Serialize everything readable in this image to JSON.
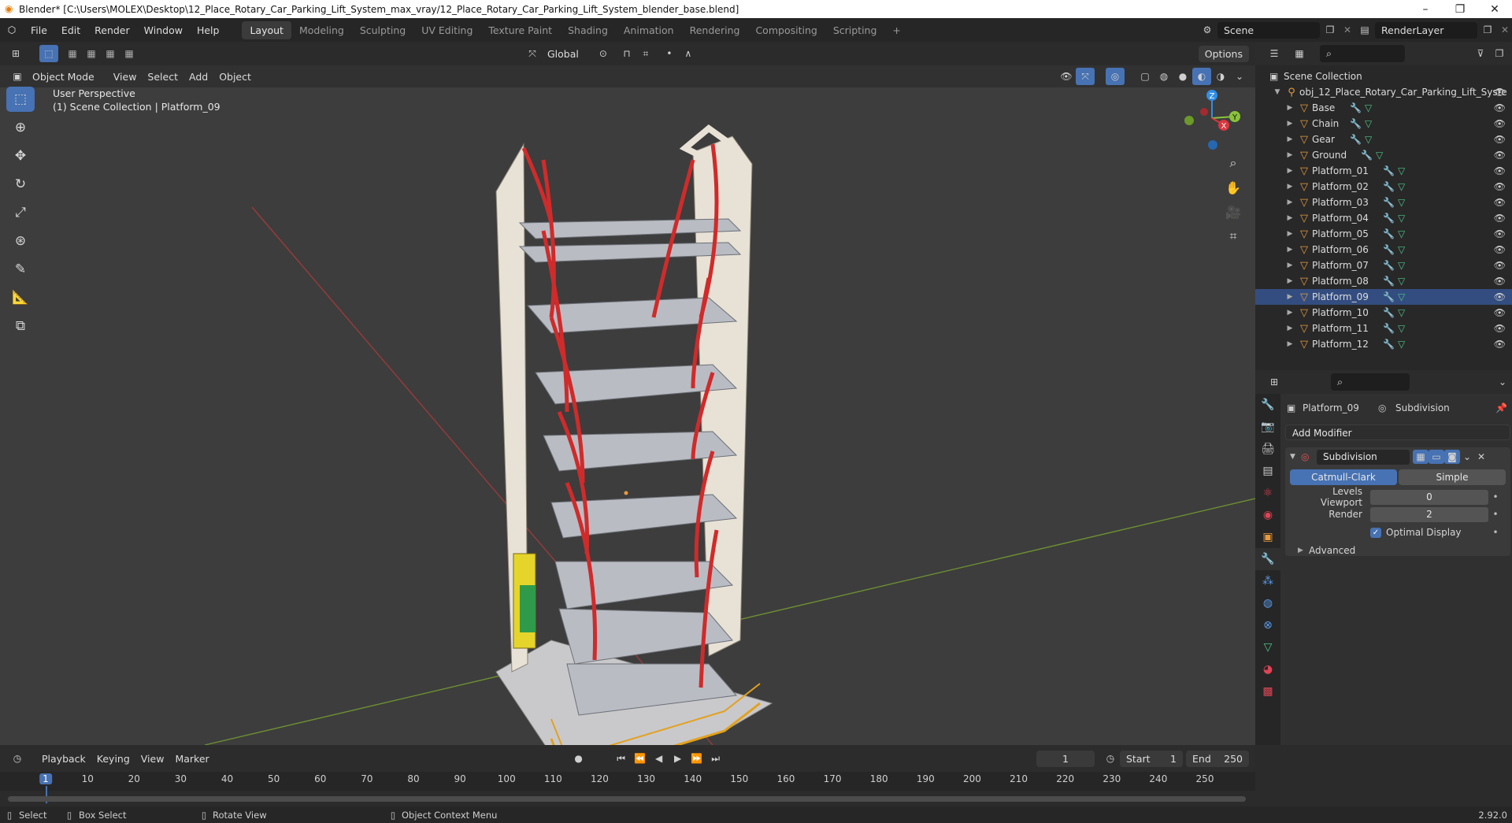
{
  "window": {
    "title": "Blender* [C:\\Users\\MOLEX\\Desktop\\12_Place_Rotary_Car_Parking_Lift_System_max_vray/12_Place_Rotary_Car_Parking_Lift_System_blender_base.blend]",
    "minimize": "–",
    "maximize": "❐",
    "close": "✕"
  },
  "menu": [
    "File",
    "Edit",
    "Render",
    "Window",
    "Help"
  ],
  "workspaces": [
    "Layout",
    "Modeling",
    "Sculpting",
    "UV Editing",
    "Texture Paint",
    "Shading",
    "Animation",
    "Rendering",
    "Compositing",
    "Scripting",
    "+"
  ],
  "scene": {
    "label": "Scene",
    "render_layer": "RenderLayer"
  },
  "viewport": {
    "mode": "Object Mode",
    "menus": [
      "View",
      "Select",
      "Add",
      "Object"
    ],
    "orientation": "Global",
    "options": "Options",
    "perspective": "User Perspective",
    "collection_info": "(1) Scene Collection | Platform_09",
    "gizmo": {
      "z": "Z",
      "y": "Y",
      "x": "X"
    }
  },
  "outliner": {
    "root": "Scene Collection",
    "collection": "obj_12_Place_Rotary_Car_Parking_Lift_Syste",
    "items": [
      "Base",
      "Chain",
      "Gear",
      "Ground",
      "Platform_01",
      "Platform_02",
      "Platform_03",
      "Platform_04",
      "Platform_05",
      "Platform_06",
      "Platform_07",
      "Platform_08",
      "Platform_09",
      "Platform_10",
      "Platform_11",
      "Platform_12"
    ],
    "selected": "Platform_09"
  },
  "properties": {
    "object": "Platform_09",
    "modifier_tab": "Subdivision",
    "add_modifier": "Add Modifier",
    "modifier_name": "Subdivision",
    "catmull": "Catmull-Clark",
    "simple": "Simple",
    "levels_label": "Levels Viewport",
    "levels_value": "0",
    "render_label": "Render",
    "render_value": "2",
    "optimal": "Optimal Display",
    "advanced": "Advanced"
  },
  "timeline": {
    "menus": [
      "Playback",
      "Keying",
      "View",
      "Marker"
    ],
    "current_frame": "1",
    "start_label": "Start",
    "start": "1",
    "end_label": "End",
    "end": "250",
    "ticks": [
      "1",
      "10",
      "20",
      "30",
      "40",
      "50",
      "60",
      "70",
      "80",
      "90",
      "100",
      "110",
      "120",
      "130",
      "140",
      "150",
      "160",
      "170",
      "180",
      "190",
      "200",
      "210",
      "220",
      "230",
      "240",
      "250"
    ]
  },
  "status": {
    "select": "Select",
    "box_select": "Box Select",
    "rotate": "Rotate View",
    "context": "Object Context Menu",
    "version": "2.92.0"
  },
  "colors": {
    "accent": "#4772b3",
    "object": "#e89a3c",
    "mesh": "#4fc48a",
    "x_axis": "#d9363e",
    "y_axis": "#8ac33a",
    "z_axis": "#2f8ee8"
  }
}
